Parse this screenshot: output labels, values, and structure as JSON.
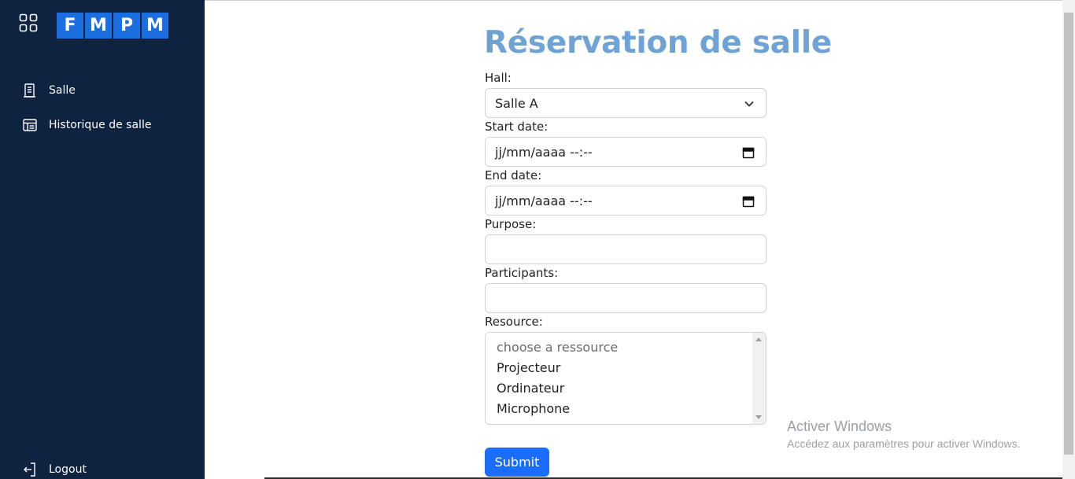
{
  "sidebar": {
    "logo_letters": [
      "F",
      "M",
      "P",
      "M"
    ],
    "items": [
      {
        "label": "Salle",
        "icon": "building-icon"
      },
      {
        "label": "Historique de salle",
        "icon": "table-icon"
      }
    ],
    "logout_label": "Logout",
    "background": "#0f2340"
  },
  "form": {
    "title": "Réservation de salle",
    "hall_label": "Hall:",
    "hall_value": "Salle A",
    "start_label": "Start date:",
    "start_value": "jj/mm/aaaa --:--",
    "end_label": "End date:",
    "end_value": "jj/mm/aaaa --:--",
    "purpose_label": "Purpose:",
    "purpose_value": "",
    "participants_label": "Participants:",
    "participants_value": "",
    "resource_label": "Resource:",
    "resource_options": [
      "choose a ressource",
      "Projecteur",
      "Ordinateur",
      "Microphone"
    ],
    "submit_label": "Submit",
    "accent": "#1b6efd",
    "title_color": "#6fa3d6"
  },
  "watermark": {
    "line1": "Activer Windows",
    "line2": "Accédez aux paramètres pour activer Windows."
  }
}
